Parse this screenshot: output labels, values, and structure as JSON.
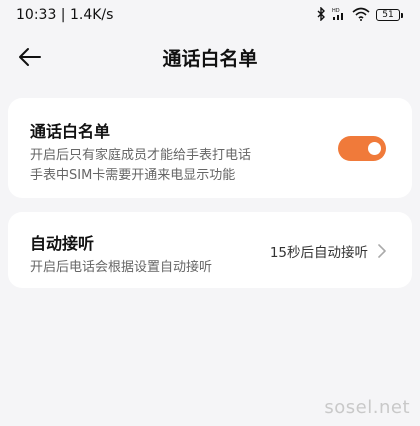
{
  "status_bar": {
    "time_speed": "10:33 | 1.4K/s",
    "battery_level": "51",
    "icons": [
      "bluetooth-icon",
      "hd-signal-icon",
      "wifi-icon",
      "battery-icon"
    ]
  },
  "header": {
    "back_icon": "back-arrow-icon",
    "title": "通话白名单"
  },
  "whitelist_card": {
    "title": "通话白名单",
    "description_line1": "开启后只有家庭成员才能给手表打电话",
    "description_line2": "手表中SIM卡需要开通来电显示功能",
    "toggle_on": true
  },
  "auto_answer_card": {
    "title": "自动接听",
    "description": "开启后电话会根据设置自动接听",
    "value": "15秒后自动接听",
    "chevron_icon": "chevron-right-icon"
  },
  "watermark": "sosel.net",
  "colors": {
    "accent": "#f07a3a",
    "background": "#f5f5f7",
    "card": "#ffffff"
  }
}
